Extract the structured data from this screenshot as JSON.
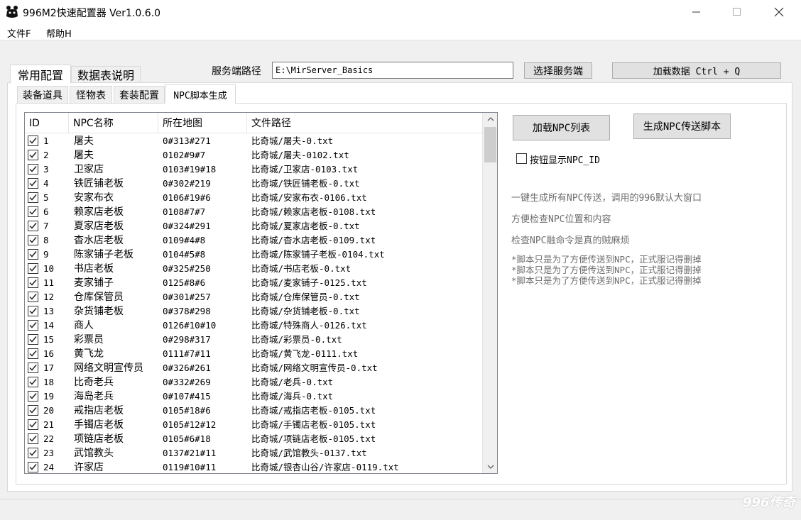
{
  "window": {
    "title": "996M2快速配置器 Ver1.0.6.0",
    "minimize_icon": "minimize-icon",
    "maximize_icon": "maximize-icon",
    "close_icon": "close-icon"
  },
  "menu": {
    "items": [
      "文件F",
      "帮助H"
    ]
  },
  "top_tabs": [
    "常用配置",
    "数据表说明"
  ],
  "server": {
    "label": "服务端路径",
    "path_value": "E:\\MirServer_Basics",
    "select_button": "选择服务端",
    "load_button": "加载数据 Ctrl + Q"
  },
  "sub_tabs": [
    "装备道具",
    "怪物表",
    "套装配置",
    "NPC脚本生成"
  ],
  "table": {
    "columns": [
      "ID",
      "NPC名称",
      "所在地图",
      "文件路径"
    ],
    "rows": [
      {
        "id": "1",
        "name": "屠夫",
        "map": "0#313#271",
        "path": "比奇城/屠夫-0.txt"
      },
      {
        "id": "2",
        "name": "屠夫",
        "map": "0102#9#7",
        "path": "比奇城/屠夫-0102.txt"
      },
      {
        "id": "3",
        "name": "卫家店",
        "map": "0103#19#18",
        "path": "比奇城/卫家店-0103.txt"
      },
      {
        "id": "4",
        "name": "铁匠铺老板",
        "map": "0#302#219",
        "path": "比奇城/铁匠铺老板-0.txt"
      },
      {
        "id": "5",
        "name": "安家布衣",
        "map": "0106#19#6",
        "path": "比奇城/安家布衣-0106.txt"
      },
      {
        "id": "6",
        "name": "赖家店老板",
        "map": "0108#7#7",
        "path": "比奇城/赖家店老板-0108.txt"
      },
      {
        "id": "7",
        "name": "夏家店老板",
        "map": "0#324#291",
        "path": "比奇城/夏家店老板-0.txt"
      },
      {
        "id": "8",
        "name": "杳水店老板",
        "map": "0109#4#8",
        "path": "比奇城/杳水店老板-0109.txt"
      },
      {
        "id": "9",
        "name": "陈家铺子老板",
        "map": "0104#5#8",
        "path": "比奇城/陈家铺子老板-0104.txt"
      },
      {
        "id": "10",
        "name": "书店老板",
        "map": "0#325#250",
        "path": "比奇城/书店老板-0.txt"
      },
      {
        "id": "11",
        "name": "麦家铺子",
        "map": "0125#8#6",
        "path": "比奇城/麦家铺子-0125.txt"
      },
      {
        "id": "12",
        "name": "仓库保管员",
        "map": "0#301#257",
        "path": "比奇城/仓库保管员-0.txt"
      },
      {
        "id": "13",
        "name": "杂货铺老板",
        "map": "0#378#298",
        "path": "比奇城/杂货铺老板-0.txt"
      },
      {
        "id": "14",
        "name": "商人",
        "map": "0126#10#10",
        "path": "比奇城/特殊商人-0126.txt"
      },
      {
        "id": "15",
        "name": "彩票员",
        "map": "0#298#317",
        "path": "比奇城/彩票员-0.txt"
      },
      {
        "id": "16",
        "name": "黄飞龙",
        "map": "0111#7#11",
        "path": "比奇城/黄飞龙-0111.txt"
      },
      {
        "id": "17",
        "name": "网络文明宣传员",
        "map": "0#326#261",
        "path": "比奇城/网络文明宣传员-0.txt"
      },
      {
        "id": "18",
        "name": "比奇老兵",
        "map": "0#332#269",
        "path": "比奇城/老兵-0.txt"
      },
      {
        "id": "19",
        "name": "海岛老兵",
        "map": "0#107#415",
        "path": "比奇城/海兵-0.txt"
      },
      {
        "id": "20",
        "name": "戒指店老板",
        "map": "0105#18#6",
        "path": "比奇城/戒指店老板-0105.txt"
      },
      {
        "id": "21",
        "name": "手镯店老板",
        "map": "0105#12#12",
        "path": "比奇城/手镯店老板-0105.txt"
      },
      {
        "id": "22",
        "name": "项链店老板",
        "map": "0105#6#18",
        "path": "比奇城/项链店老板-0105.txt"
      },
      {
        "id": "23",
        "name": "武馆教头",
        "map": "0137#21#11",
        "path": "比奇城/武馆教头-0137.txt"
      },
      {
        "id": "24",
        "name": "许家店",
        "map": "0119#10#11",
        "path": "比奇城/银杏山谷/许家店-0119.txt"
      }
    ]
  },
  "right_panel": {
    "load_npc_button": "加载NPC列表",
    "generate_button": "生成NPC传送脚本",
    "checkbox_label": "按钮显示NPC_ID",
    "info_lines": [
      "一键生成所有NPC传送，调用的996默认大窗口",
      "方便检查NPC位置和内容",
      "检查NPC融命令是真的贼麻烦"
    ],
    "notes": [
      "*脚本只是为了方便传送到NPC，正式服记得删掉",
      "*脚本只是为了方便传送到NPC，正式服记得删掉",
      "*脚本只是为了方便传送到NPC，正式服记得删掉"
    ]
  },
  "watermark": "996传奇"
}
